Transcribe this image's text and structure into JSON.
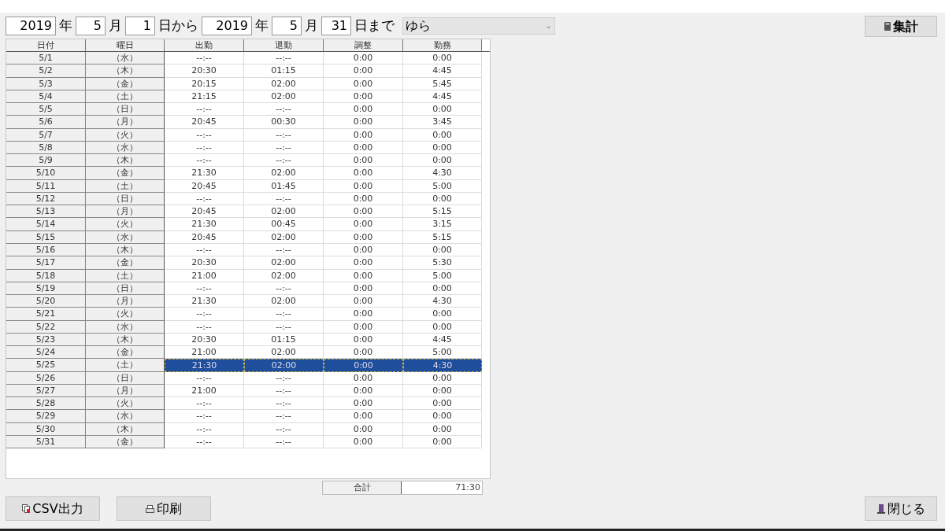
{
  "period": {
    "from_year": "2019",
    "year_label_1": "年",
    "from_month": "5",
    "month_label_1": "月",
    "from_day": "1",
    "from_day_label": "日から",
    "to_year": "2019",
    "year_label_2": "年",
    "to_month": "5",
    "month_label_2": "月",
    "to_day": "31",
    "to_day_label": "日まで"
  },
  "employee_select": {
    "value": "ゆら",
    "arrow": "⌄"
  },
  "buttons": {
    "tally": "集計",
    "csv": "CSV出力",
    "print": "印刷",
    "close": "閉じる"
  },
  "table": {
    "columns": [
      "日付",
      "曜日",
      "出勤",
      "退勤",
      "調整",
      "勤務"
    ],
    "rows": [
      {
        "cells": [
          "5/1",
          "（水）",
          "--:--",
          "--:--",
          "0:00",
          "0:00"
        ],
        "selected": false
      },
      {
        "cells": [
          "5/2",
          "（木）",
          "20:30",
          "01:15",
          "0:00",
          "4:45"
        ],
        "selected": false
      },
      {
        "cells": [
          "5/3",
          "（金）",
          "20:15",
          "02:00",
          "0:00",
          "5:45"
        ],
        "selected": false
      },
      {
        "cells": [
          "5/4",
          "（土）",
          "21:15",
          "02:00",
          "0:00",
          "4:45"
        ],
        "selected": false
      },
      {
        "cells": [
          "5/5",
          "（日）",
          "--:--",
          "--:--",
          "0:00",
          "0:00"
        ],
        "selected": false
      },
      {
        "cells": [
          "5/6",
          "（月）",
          "20:45",
          "00:30",
          "0:00",
          "3:45"
        ],
        "selected": false
      },
      {
        "cells": [
          "5/7",
          "（火）",
          "--:--",
          "--:--",
          "0:00",
          "0:00"
        ],
        "selected": false
      },
      {
        "cells": [
          "5/8",
          "（水）",
          "--:--",
          "--:--",
          "0:00",
          "0:00"
        ],
        "selected": false
      },
      {
        "cells": [
          "5/9",
          "（木）",
          "--:--",
          "--:--",
          "0:00",
          "0:00"
        ],
        "selected": false
      },
      {
        "cells": [
          "5/10",
          "（金）",
          "21:30",
          "02:00",
          "0:00",
          "4:30"
        ],
        "selected": false
      },
      {
        "cells": [
          "5/11",
          "（土）",
          "20:45",
          "01:45",
          "0:00",
          "5:00"
        ],
        "selected": false
      },
      {
        "cells": [
          "5/12",
          "（日）",
          "--:--",
          "--:--",
          "0:00",
          "0:00"
        ],
        "selected": false
      },
      {
        "cells": [
          "5/13",
          "（月）",
          "20:45",
          "02:00",
          "0:00",
          "5:15"
        ],
        "selected": false
      },
      {
        "cells": [
          "5/14",
          "（火）",
          "21:30",
          "00:45",
          "0:00",
          "3:15"
        ],
        "selected": false
      },
      {
        "cells": [
          "5/15",
          "（水）",
          "20:45",
          "02:00",
          "0:00",
          "5:15"
        ],
        "selected": false
      },
      {
        "cells": [
          "5/16",
          "（木）",
          "--:--",
          "--:--",
          "0:00",
          "0:00"
        ],
        "selected": false
      },
      {
        "cells": [
          "5/17",
          "（金）",
          "20:30",
          "02:00",
          "0:00",
          "5:30"
        ],
        "selected": false
      },
      {
        "cells": [
          "5/18",
          "（土）",
          "21:00",
          "02:00",
          "0:00",
          "5:00"
        ],
        "selected": false
      },
      {
        "cells": [
          "5/19",
          "（日）",
          "--:--",
          "--:--",
          "0:00",
          "0:00"
        ],
        "selected": false
      },
      {
        "cells": [
          "5/20",
          "（月）",
          "21:30",
          "02:00",
          "0:00",
          "4:30"
        ],
        "selected": false
      },
      {
        "cells": [
          "5/21",
          "（火）",
          "--:--",
          "--:--",
          "0:00",
          "0:00"
        ],
        "selected": false
      },
      {
        "cells": [
          "5/22",
          "（水）",
          "--:--",
          "--:--",
          "0:00",
          "0:00"
        ],
        "selected": false
      },
      {
        "cells": [
          "5/23",
          "（木）",
          "20:30",
          "01:15",
          "0:00",
          "4:45"
        ],
        "selected": false
      },
      {
        "cells": [
          "5/24",
          "（金）",
          "21:00",
          "02:00",
          "0:00",
          "5:00"
        ],
        "selected": false
      },
      {
        "cells": [
          "5/25",
          "（土）",
          "21:30",
          "02:00",
          "0:00",
          "4:30"
        ],
        "selected": true
      },
      {
        "cells": [
          "5/26",
          "（日）",
          "--:--",
          "--:--",
          "0:00",
          "0:00"
        ],
        "selected": false
      },
      {
        "cells": [
          "5/27",
          "（月）",
          "21:00",
          "--:--",
          "0:00",
          "0:00"
        ],
        "selected": false
      },
      {
        "cells": [
          "5/28",
          "（火）",
          "--:--",
          "--:--",
          "0:00",
          "0:00"
        ],
        "selected": false
      },
      {
        "cells": [
          "5/29",
          "（水）",
          "--:--",
          "--:--",
          "0:00",
          "0:00"
        ],
        "selected": false
      },
      {
        "cells": [
          "5/30",
          "（木）",
          "--:--",
          "--:--",
          "0:00",
          "0:00"
        ],
        "selected": false
      },
      {
        "cells": [
          "5/31",
          "（金）",
          "--:--",
          "--:--",
          "0:00",
          "0:00"
        ],
        "selected": false
      }
    ]
  },
  "total": {
    "label": "合計",
    "value": "71:30"
  }
}
